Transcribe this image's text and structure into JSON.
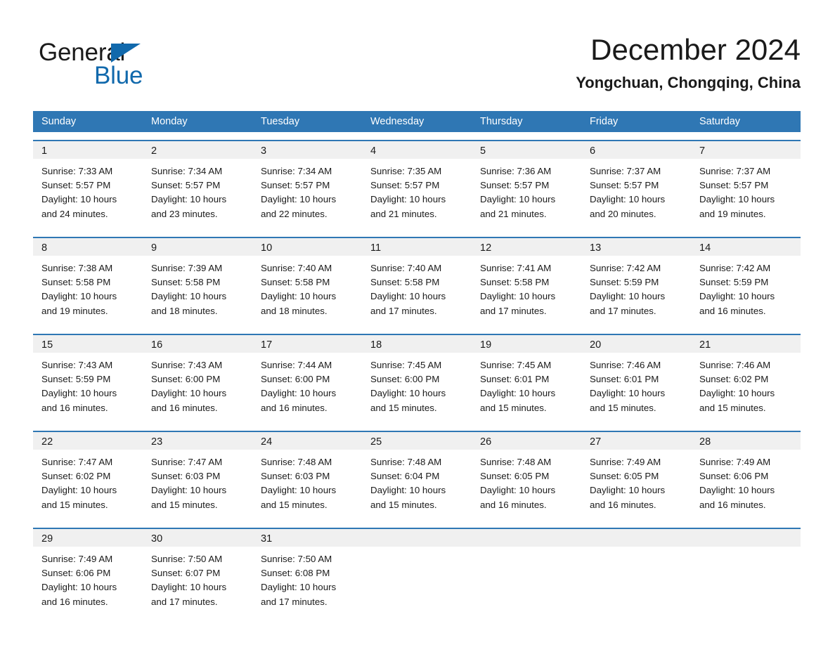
{
  "brand": {
    "name_dark": "General",
    "name_light": "Blue",
    "triangle_color": "#1169ac"
  },
  "header": {
    "title": "December 2024",
    "subtitle": "Yongchuan, Chongqing, China"
  },
  "theme": {
    "accent": "#2f77b4",
    "daynum_bg": "#f0f0f0",
    "text": "#1a1a1a",
    "header_text": "#ffffff"
  },
  "weekdays": [
    "Sunday",
    "Monday",
    "Tuesday",
    "Wednesday",
    "Thursday",
    "Friday",
    "Saturday"
  ],
  "weeks": [
    {
      "days": [
        {
          "num": "1",
          "sunrise": "Sunrise: 7:33 AM",
          "sunset": "Sunset: 5:57 PM",
          "daylight1": "Daylight: 10 hours",
          "daylight2": "and 24 minutes."
        },
        {
          "num": "2",
          "sunrise": "Sunrise: 7:34 AM",
          "sunset": "Sunset: 5:57 PM",
          "daylight1": "Daylight: 10 hours",
          "daylight2": "and 23 minutes."
        },
        {
          "num": "3",
          "sunrise": "Sunrise: 7:34 AM",
          "sunset": "Sunset: 5:57 PM",
          "daylight1": "Daylight: 10 hours",
          "daylight2": "and 22 minutes."
        },
        {
          "num": "4",
          "sunrise": "Sunrise: 7:35 AM",
          "sunset": "Sunset: 5:57 PM",
          "daylight1": "Daylight: 10 hours",
          "daylight2": "and 21 minutes."
        },
        {
          "num": "5",
          "sunrise": "Sunrise: 7:36 AM",
          "sunset": "Sunset: 5:57 PM",
          "daylight1": "Daylight: 10 hours",
          "daylight2": "and 21 minutes."
        },
        {
          "num": "6",
          "sunrise": "Sunrise: 7:37 AM",
          "sunset": "Sunset: 5:57 PM",
          "daylight1": "Daylight: 10 hours",
          "daylight2": "and 20 minutes."
        },
        {
          "num": "7",
          "sunrise": "Sunrise: 7:37 AM",
          "sunset": "Sunset: 5:57 PM",
          "daylight1": "Daylight: 10 hours",
          "daylight2": "and 19 minutes."
        }
      ]
    },
    {
      "days": [
        {
          "num": "8",
          "sunrise": "Sunrise: 7:38 AM",
          "sunset": "Sunset: 5:58 PM",
          "daylight1": "Daylight: 10 hours",
          "daylight2": "and 19 minutes."
        },
        {
          "num": "9",
          "sunrise": "Sunrise: 7:39 AM",
          "sunset": "Sunset: 5:58 PM",
          "daylight1": "Daylight: 10 hours",
          "daylight2": "and 18 minutes."
        },
        {
          "num": "10",
          "sunrise": "Sunrise: 7:40 AM",
          "sunset": "Sunset: 5:58 PM",
          "daylight1": "Daylight: 10 hours",
          "daylight2": "and 18 minutes."
        },
        {
          "num": "11",
          "sunrise": "Sunrise: 7:40 AM",
          "sunset": "Sunset: 5:58 PM",
          "daylight1": "Daylight: 10 hours",
          "daylight2": "and 17 minutes."
        },
        {
          "num": "12",
          "sunrise": "Sunrise: 7:41 AM",
          "sunset": "Sunset: 5:58 PM",
          "daylight1": "Daylight: 10 hours",
          "daylight2": "and 17 minutes."
        },
        {
          "num": "13",
          "sunrise": "Sunrise: 7:42 AM",
          "sunset": "Sunset: 5:59 PM",
          "daylight1": "Daylight: 10 hours",
          "daylight2": "and 17 minutes."
        },
        {
          "num": "14",
          "sunrise": "Sunrise: 7:42 AM",
          "sunset": "Sunset: 5:59 PM",
          "daylight1": "Daylight: 10 hours",
          "daylight2": "and 16 minutes."
        }
      ]
    },
    {
      "days": [
        {
          "num": "15",
          "sunrise": "Sunrise: 7:43 AM",
          "sunset": "Sunset: 5:59 PM",
          "daylight1": "Daylight: 10 hours",
          "daylight2": "and 16 minutes."
        },
        {
          "num": "16",
          "sunrise": "Sunrise: 7:43 AM",
          "sunset": "Sunset: 6:00 PM",
          "daylight1": "Daylight: 10 hours",
          "daylight2": "and 16 minutes."
        },
        {
          "num": "17",
          "sunrise": "Sunrise: 7:44 AM",
          "sunset": "Sunset: 6:00 PM",
          "daylight1": "Daylight: 10 hours",
          "daylight2": "and 16 minutes."
        },
        {
          "num": "18",
          "sunrise": "Sunrise: 7:45 AM",
          "sunset": "Sunset: 6:00 PM",
          "daylight1": "Daylight: 10 hours",
          "daylight2": "and 15 minutes."
        },
        {
          "num": "19",
          "sunrise": "Sunrise: 7:45 AM",
          "sunset": "Sunset: 6:01 PM",
          "daylight1": "Daylight: 10 hours",
          "daylight2": "and 15 minutes."
        },
        {
          "num": "20",
          "sunrise": "Sunrise: 7:46 AM",
          "sunset": "Sunset: 6:01 PM",
          "daylight1": "Daylight: 10 hours",
          "daylight2": "and 15 minutes."
        },
        {
          "num": "21",
          "sunrise": "Sunrise: 7:46 AM",
          "sunset": "Sunset: 6:02 PM",
          "daylight1": "Daylight: 10 hours",
          "daylight2": "and 15 minutes."
        }
      ]
    },
    {
      "days": [
        {
          "num": "22",
          "sunrise": "Sunrise: 7:47 AM",
          "sunset": "Sunset: 6:02 PM",
          "daylight1": "Daylight: 10 hours",
          "daylight2": "and 15 minutes."
        },
        {
          "num": "23",
          "sunrise": "Sunrise: 7:47 AM",
          "sunset": "Sunset: 6:03 PM",
          "daylight1": "Daylight: 10 hours",
          "daylight2": "and 15 minutes."
        },
        {
          "num": "24",
          "sunrise": "Sunrise: 7:48 AM",
          "sunset": "Sunset: 6:03 PM",
          "daylight1": "Daylight: 10 hours",
          "daylight2": "and 15 minutes."
        },
        {
          "num": "25",
          "sunrise": "Sunrise: 7:48 AM",
          "sunset": "Sunset: 6:04 PM",
          "daylight1": "Daylight: 10 hours",
          "daylight2": "and 15 minutes."
        },
        {
          "num": "26",
          "sunrise": "Sunrise: 7:48 AM",
          "sunset": "Sunset: 6:05 PM",
          "daylight1": "Daylight: 10 hours",
          "daylight2": "and 16 minutes."
        },
        {
          "num": "27",
          "sunrise": "Sunrise: 7:49 AM",
          "sunset": "Sunset: 6:05 PM",
          "daylight1": "Daylight: 10 hours",
          "daylight2": "and 16 minutes."
        },
        {
          "num": "28",
          "sunrise": "Sunrise: 7:49 AM",
          "sunset": "Sunset: 6:06 PM",
          "daylight1": "Daylight: 10 hours",
          "daylight2": "and 16 minutes."
        }
      ]
    },
    {
      "days": [
        {
          "num": "29",
          "sunrise": "Sunrise: 7:49 AM",
          "sunset": "Sunset: 6:06 PM",
          "daylight1": "Daylight: 10 hours",
          "daylight2": "and 16 minutes."
        },
        {
          "num": "30",
          "sunrise": "Sunrise: 7:50 AM",
          "sunset": "Sunset: 6:07 PM",
          "daylight1": "Daylight: 10 hours",
          "daylight2": "and 17 minutes."
        },
        {
          "num": "31",
          "sunrise": "Sunrise: 7:50 AM",
          "sunset": "Sunset: 6:08 PM",
          "daylight1": "Daylight: 10 hours",
          "daylight2": "and 17 minutes."
        },
        {
          "num": "",
          "sunrise": "",
          "sunset": "",
          "daylight1": "",
          "daylight2": ""
        },
        {
          "num": "",
          "sunrise": "",
          "sunset": "",
          "daylight1": "",
          "daylight2": ""
        },
        {
          "num": "",
          "sunrise": "",
          "sunset": "",
          "daylight1": "",
          "daylight2": ""
        },
        {
          "num": "",
          "sunrise": "",
          "sunset": "",
          "daylight1": "",
          "daylight2": ""
        }
      ]
    }
  ]
}
